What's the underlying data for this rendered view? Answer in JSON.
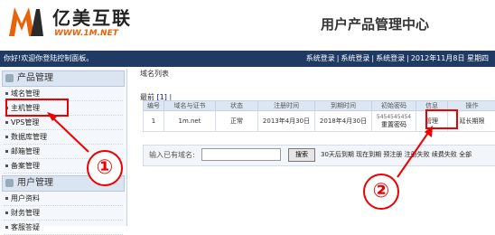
{
  "header": {
    "logo_text": "亿美互联",
    "logo_url": "WWW.1M.NET",
    "title": "用户产品管理中心"
  },
  "topbar": {
    "greeting": "你好!",
    "username": "",
    "welcome": "欢迎你登陆控制面板。",
    "links": [
      "系统登录",
      "系统登录",
      "系统登录"
    ],
    "separator": "|",
    "date": "2012年11月8日 星期四"
  },
  "sidebar": {
    "groups": [
      {
        "label": "产品管理",
        "icon": "product-icon",
        "items": [
          "域名管理",
          "主机管理",
          "VPS管理",
          "数据库管理",
          "邮箱管理",
          "备案管理"
        ]
      },
      {
        "label": "用户管理",
        "icon": "user-icon",
        "items": [
          "用户资料",
          "财务管理",
          "客服答疑"
        ]
      }
    ]
  },
  "main": {
    "list_title": "域名列表",
    "pager": {
      "label": "最前",
      "current": "[1]",
      "sep": "|"
    },
    "table": {
      "headers": [
        "编号",
        "域名与证书",
        "状态",
        "注册时间",
        "到期时间",
        "初始密码",
        "信息",
        "操作"
      ],
      "rows": [
        {
          "id": "1",
          "domain": "1m.net",
          "status": "正常",
          "registered": "2013年4月30日",
          "expires": "2018年4月30日",
          "password": "5454545454",
          "reset": "重置密码",
          "info": "管理",
          "action": "延长期限"
        }
      ]
    },
    "filter": {
      "label": "输入已有域名:",
      "input_value": "",
      "button": "搜索",
      "links": [
        "30天后到期",
        "现在到期",
        "预注册",
        "注册失败",
        "续费失败",
        "全部"
      ]
    }
  },
  "annotations": {
    "marker1": "①",
    "marker2": "②"
  },
  "colors": {
    "accent": "#1f3a63",
    "annotation": "#ee0000",
    "logo_orange": "#e8620a"
  }
}
